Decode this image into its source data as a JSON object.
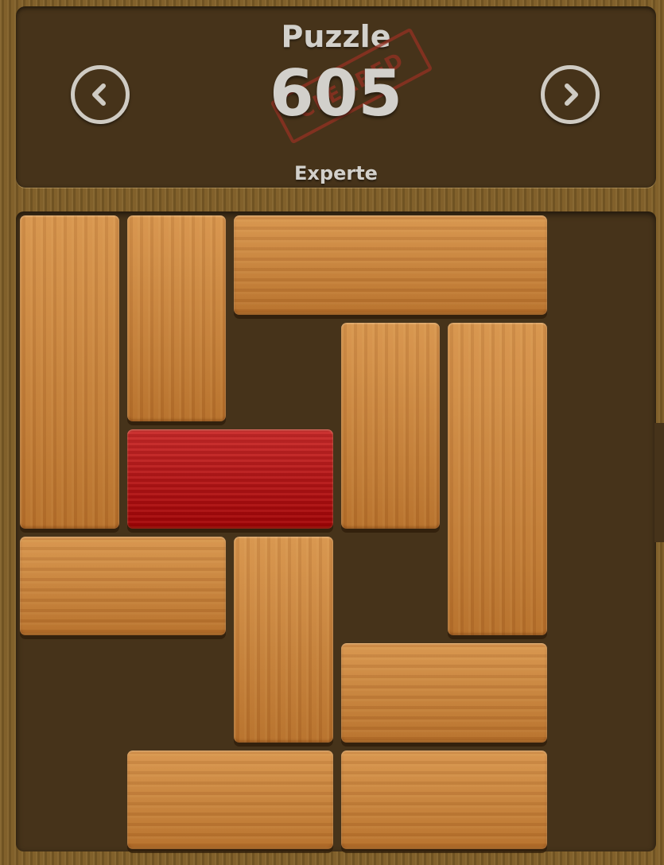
{
  "header": {
    "title": "Puzzle",
    "puzzle_number": "605",
    "difficulty": "Experte",
    "stamp_text": "CLEARED",
    "prev_icon": "chevron-left-icon",
    "next_icon": "chevron-right-icon"
  },
  "board": {
    "grid_size": 6,
    "target_color": "#b30407",
    "block_color": "#c97c30",
    "blocks": [
      {
        "id": "block-1",
        "col": 0,
        "row": 0,
        "w": 1,
        "h": 3,
        "target": false
      },
      {
        "id": "block-2",
        "col": 1,
        "row": 0,
        "w": 1,
        "h": 2,
        "target": false
      },
      {
        "id": "block-3",
        "col": 2,
        "row": 0,
        "w": 3,
        "h": 1,
        "target": false
      },
      {
        "id": "block-4",
        "col": 3,
        "row": 1,
        "w": 1,
        "h": 2,
        "target": false
      },
      {
        "id": "block-5",
        "col": 4,
        "row": 1,
        "w": 1,
        "h": 3,
        "target": false
      },
      {
        "id": "target-block",
        "col": 1,
        "row": 2,
        "w": 2,
        "h": 1,
        "target": true
      },
      {
        "id": "block-6",
        "col": 0,
        "row": 3,
        "w": 2,
        "h": 1,
        "target": false
      },
      {
        "id": "block-7",
        "col": 2,
        "row": 3,
        "w": 1,
        "h": 2,
        "target": false
      },
      {
        "id": "block-8",
        "col": 3,
        "row": 4,
        "w": 2,
        "h": 1,
        "target": false
      },
      {
        "id": "block-9",
        "col": 1,
        "row": 5,
        "w": 2,
        "h": 1,
        "target": false
      },
      {
        "id": "block-10",
        "col": 3,
        "row": 5,
        "w": 2,
        "h": 1,
        "target": false
      }
    ]
  }
}
